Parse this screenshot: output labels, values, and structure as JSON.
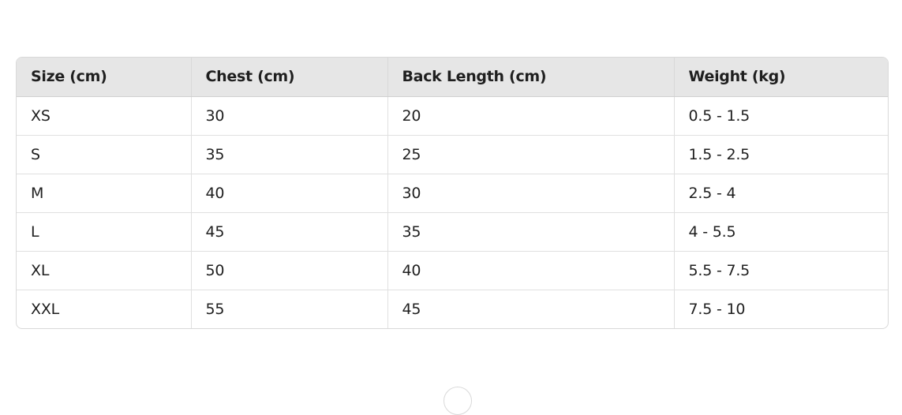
{
  "table": {
    "columns": [
      "Size (cm)",
      "Chest (cm)",
      "Back Length (cm)",
      "Weight (kg)"
    ],
    "rows": [
      [
        "XS",
        "30",
        "20",
        "0.5 - 1.5"
      ],
      [
        "S",
        "35",
        "25",
        "1.5 - 2.5"
      ],
      [
        "M",
        "40",
        "30",
        "2.5 - 4"
      ],
      [
        "L",
        "45",
        "35",
        "4 - 5.5"
      ],
      [
        "XL",
        "50",
        "40",
        "5.5 - 7.5"
      ],
      [
        "XXL",
        "55",
        "45",
        "7.5 - 10"
      ]
    ]
  }
}
